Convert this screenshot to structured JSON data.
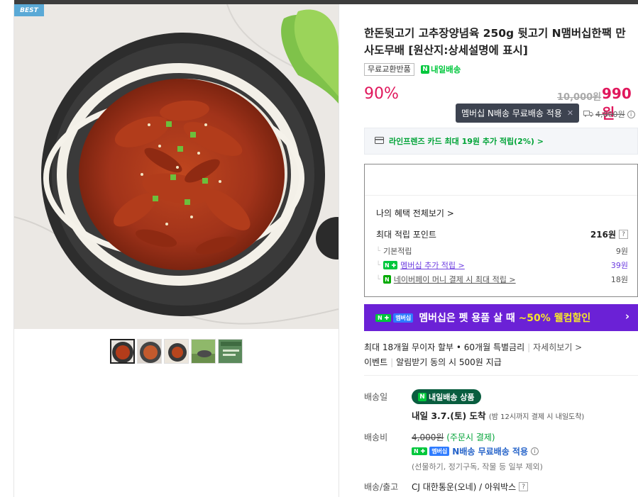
{
  "badge": {
    "best": "BEST"
  },
  "product": {
    "title": "한돈뒷고기 고추장양념육 250g 뒷고기 N맴버십한팩 만사도무배 [원산지:상세설명에 표시]",
    "tag_exchange": "무료교환반품",
    "tag_delivery": "내일배송",
    "discount": "90%",
    "original_price": "10,000원",
    "sale_price": "990원"
  },
  "tooltip": {
    "text": "멤버십 N배송 무료배송 적용",
    "close": "✕"
  },
  "shipping_strike": {
    "amount": "4,000원"
  },
  "card_promo": {
    "text": "라인프렌즈 카드 최대 19원 추가 적립(2%) >"
  },
  "benefit": {
    "view_all": "나의 혜택 전체보기 >",
    "max_points_label": "최대 적립 포인트",
    "max_points_value": "216원",
    "basic_label": "기본적립",
    "basic_value": "9원",
    "membership_label": "멤버십 추가 적립 >",
    "membership_value": "39원",
    "npay_label": "네이버페이 머니 결제 시 최대 적립 >",
    "npay_value": "18원"
  },
  "banner": {
    "pre": "멤버십은 펫 용품 살 때 ",
    "highlight": "~50% 웰컴할인",
    "arrow": "›",
    "n_badge": "N ✚",
    "membership_badge": "멤버십"
  },
  "installment": {
    "text": "최대 18개월 무이자 할부 • 60개월 특별금리",
    "more": "자세히보기 >"
  },
  "event": {
    "label": "이벤트",
    "text": "알림받기 동의 시 500원 지급"
  },
  "delivery": {
    "date_label": "배송일",
    "pill": "내일배송 상품",
    "arrive": "내일 3.7.(토) 도착",
    "arrive_note": "(밤 12시까지 결제 시 내일도착)",
    "fee_label": "배송비",
    "fee_strike": "4,000원",
    "fee_note": "(주문시 결제)",
    "nfree": "N배송 무료배송 적용",
    "exclusions": "(선물하기, 정기구독, 작물 등 일부 제외)",
    "ship_from_label": "배송/출고",
    "ship_from": "CJ 대한통운(오네) / 아워박스"
  },
  "colors": {
    "accent_red": "#e0175c",
    "naver_green": "#00c73c",
    "banner_purple": "#6b21d6",
    "highlight_yellow": "#f5e62b"
  },
  "icons": {
    "card": "card-icon",
    "truck": "truck-icon",
    "info": "info-icon",
    "question": "question-icon"
  }
}
